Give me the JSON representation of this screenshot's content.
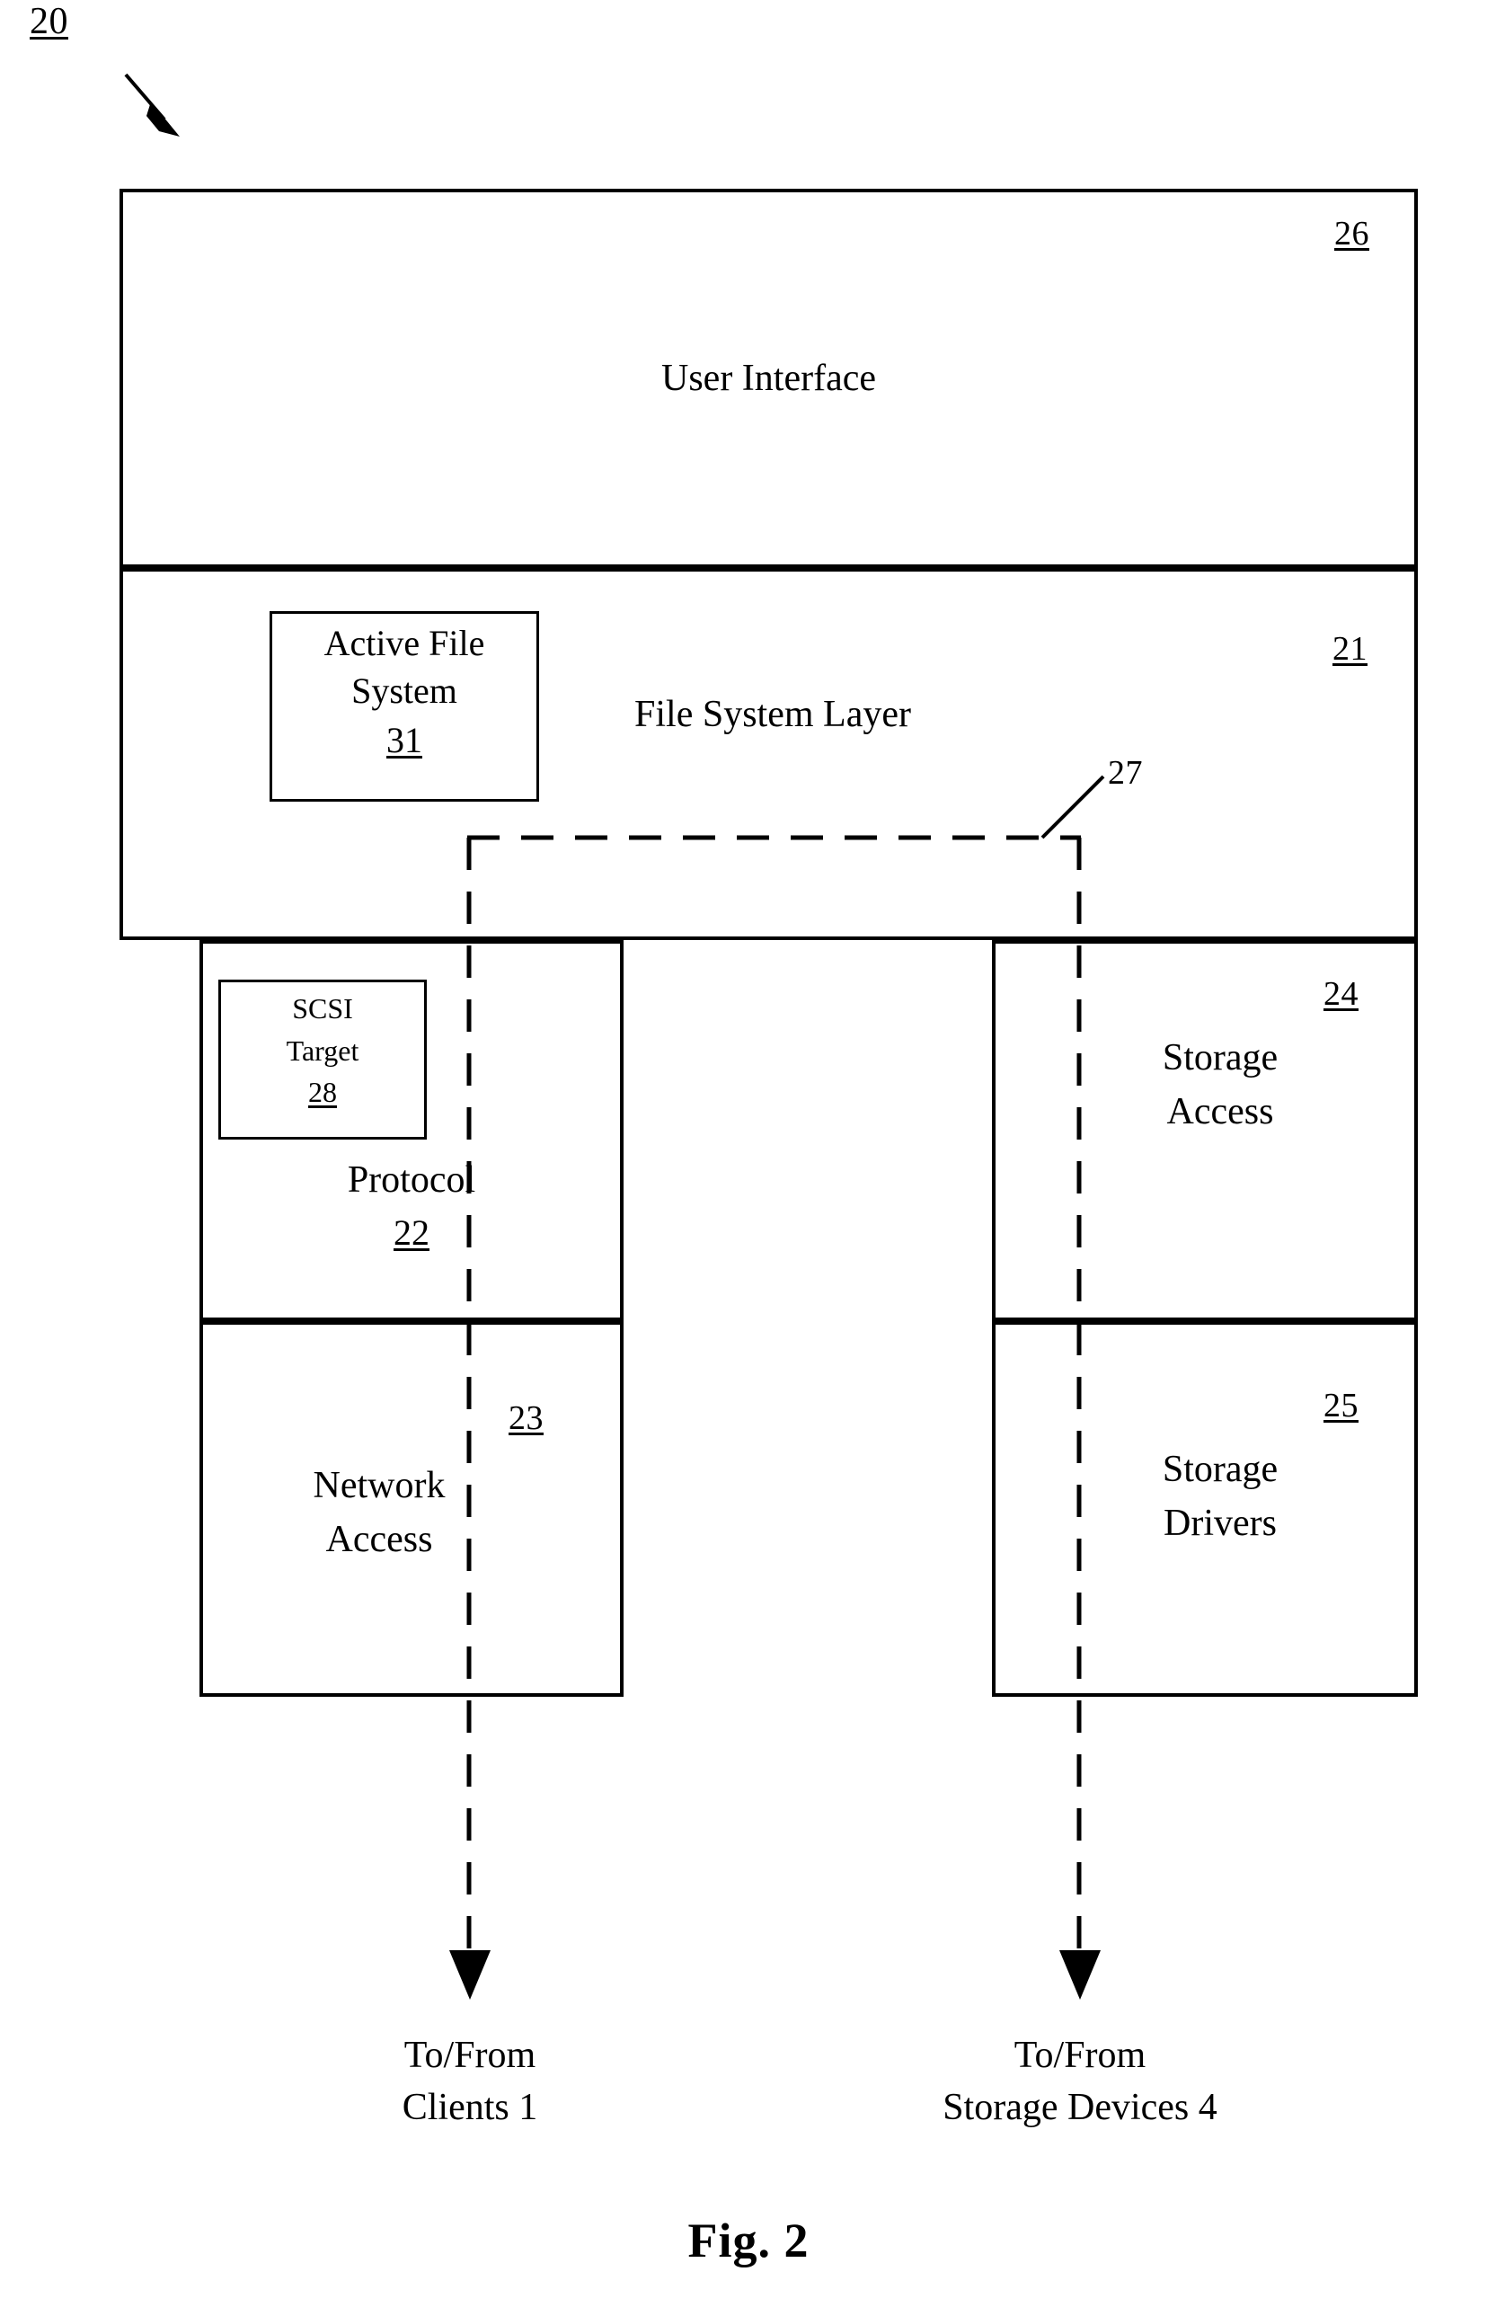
{
  "figure": {
    "caption": "Fig. 2",
    "overall_ref": "20"
  },
  "blocks": [
    {
      "name": "user-interface",
      "label": "User Interface",
      "ref": "26"
    },
    {
      "name": "file-system-layer",
      "label": "File System Layer",
      "ref": "21"
    },
    {
      "name": "active-file-system",
      "label_line1": "Active File",
      "label_line2": "System",
      "ref": "31"
    },
    {
      "name": "protocol",
      "label": "Protocol",
      "ref": "22"
    },
    {
      "name": "scsi-target",
      "label_line1": "SCSI",
      "label_line2": "Target",
      "ref": "28"
    },
    {
      "name": "network-access",
      "label_line1": "Network",
      "label_line2": "Access",
      "ref": "23"
    },
    {
      "name": "storage-access",
      "label_line1": "Storage",
      "label_line2": "Access",
      "ref": "24"
    },
    {
      "name": "storage-drivers",
      "label_line1": "Storage",
      "label_line2": "Drivers",
      "ref": "25"
    }
  ],
  "connector": {
    "ref": "27"
  },
  "endpoints": [
    {
      "name": "clients",
      "line1": "To/From",
      "line2": "Clients 1"
    },
    {
      "name": "storage-devices",
      "line1": "To/From",
      "line2": "Storage Devices 4"
    }
  ],
  "colors": {
    "ink": "#000000",
    "paper": "#ffffff"
  }
}
